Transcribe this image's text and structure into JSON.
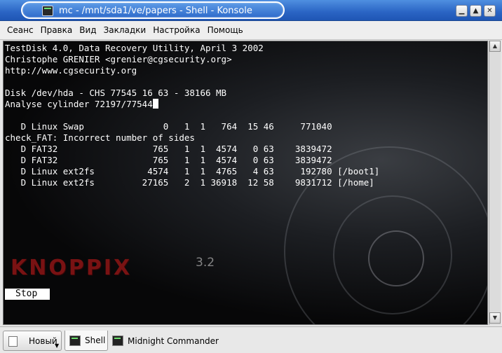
{
  "window": {
    "title": "mc - /mnt/sda1/ve/papers - Shell - Konsole",
    "buttons": {
      "minimize": "▁",
      "maximize": "▲",
      "close": "✕"
    }
  },
  "menu": [
    "Сеанс",
    "Правка",
    "Вид",
    "Закладки",
    "Настройка",
    "Помощь"
  ],
  "terminal": {
    "lines": [
      "TestDisk 4.0, Data Recovery Utility, April 3 2002",
      "Christophe GRENIER <grenier@cgsecurity.org>",
      "http://www.cgsecurity.org",
      "",
      "Disk /dev/hda - CHS 77545 16 63 - 38166 MB",
      "Analyse cylinder 72197/77544",
      "",
      "   D Linux Swap               0   1  1   764  15 46     771040",
      "check_FAT: Incorrect number of sides",
      "   D FAT32                  765   1  1  4574   0 63    3839472",
      "   D FAT32                  765   1  1  4574   0 63    3839472",
      "   D Linux ext2fs          4574   1  1  4765   4 63     192780 [/boot1]",
      "   D Linux ext2fs         27165   2  1 36918  12 58    9831712 [/home]"
    ],
    "stop_label": "Stop",
    "background_logo": "KNOPPIX",
    "background_version": "3.2"
  },
  "scrollbar": {
    "up_icon": "▲",
    "down_icon": "▼"
  },
  "tabbar": {
    "new_label": "Новый",
    "tabs": [
      {
        "label": "Shell",
        "active": true
      },
      {
        "label": "Midnight Commander",
        "active": false
      }
    ]
  }
}
